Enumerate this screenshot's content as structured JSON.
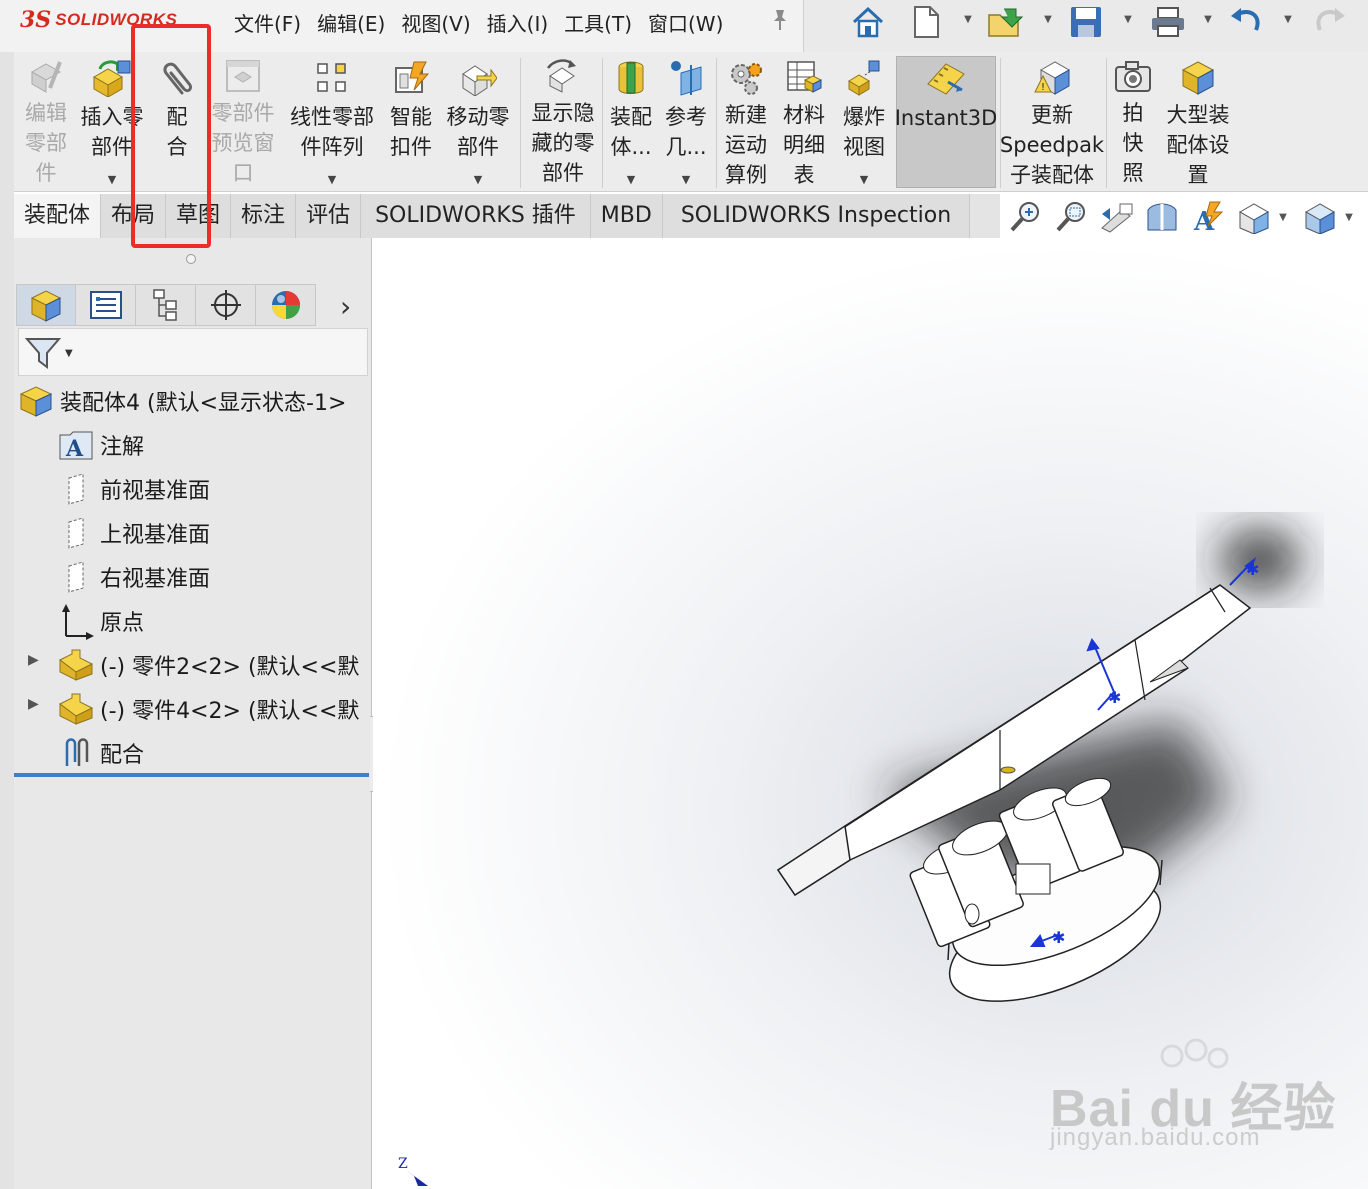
{
  "app": {
    "logo_mark": "3S",
    "logo_text": "SOLIDWORKS",
    "brand_color": "#d52b1e"
  },
  "menus": [
    "文件(F)",
    "编辑(E)",
    "视图(V)",
    "插入(I)",
    "工具(T)",
    "窗口(W)"
  ],
  "quick_access": [
    "home-icon",
    "new-document-icon",
    "open-icon",
    "save-icon",
    "print-icon",
    "undo-icon",
    "redo-icon"
  ],
  "commands": {
    "edit_component": "编辑\n零部\n件",
    "insert_component": "插入零\n部件",
    "mate": "配\n合",
    "component_preview": "零部件\n预览窗\n口",
    "linear_pattern": "线性零部\n件阵列",
    "smart_fasteners": "智能\n扣件",
    "move_component": "移动零\n部件",
    "show_hidden": "显示隐\n藏的零\n部件",
    "assembly_features": "装配\n体...",
    "reference_geometry": "参考\n几...",
    "new_motion_study": "新建\n运动\n算例",
    "bill_of_materials": "材料\n明细\n表",
    "exploded_view": "爆炸\n视图",
    "instant3d": "Instant3D",
    "update_speedpak": "更新\nSpeedpak\n子装配体",
    "snapshot": "拍\n快\n照",
    "large_assembly": "大型装\n配体设\n置"
  },
  "tabs": [
    "装配体",
    "布局",
    "草图",
    "标注",
    "评估",
    "SOLIDWORKS 插件",
    "MBD",
    "SOLIDWORKS Inspection"
  ],
  "view_tools": [
    "zoom-to-fit-icon",
    "zoom-to-area-icon",
    "previous-view-icon",
    "section-view-icon",
    "dynamic-annotation-icon",
    "view-orientation-icon",
    "display-style-icon"
  ],
  "feature_tree": {
    "root": "装配体4  (默认<显示状态-1>",
    "items": [
      {
        "label": "注解",
        "icon": "annotations-icon"
      },
      {
        "label": "前视基准面",
        "icon": "plane-icon"
      },
      {
        "label": "上视基准面",
        "icon": "plane-icon"
      },
      {
        "label": "右视基准面",
        "icon": "plane-icon"
      },
      {
        "label": "原点",
        "icon": "origin-icon"
      },
      {
        "label": "(-) 零件2<2> (默认<<默",
        "icon": "part-icon"
      },
      {
        "label": "(-) 零件4<2> (默认<<默",
        "icon": "part-icon"
      },
      {
        "label": "配合",
        "icon": "mates-icon"
      }
    ]
  },
  "triad_label": "Z",
  "watermark": {
    "line1": "Bai du 经验",
    "line2": "jingyan.baidu.com"
  },
  "highlight_color": "#ec2b2b"
}
